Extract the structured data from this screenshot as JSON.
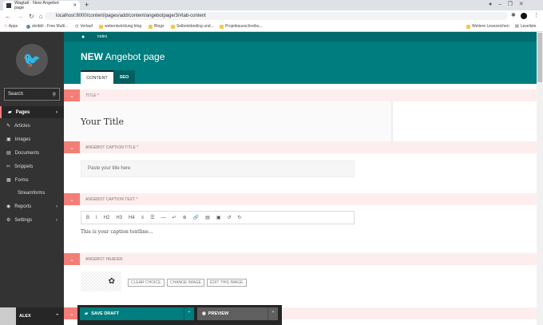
{
  "browser": {
    "tab_title": "Wagtail - New Angebot page",
    "url": "localhost:8000/content/pages/add/content/angebotpage/3/#tab-content",
    "bookmarks": [
      "Apps",
      "skribbl - Free Multi...",
      "Verlauf",
      "webentwicklung blog",
      "Blogs",
      "Selbstständing und...",
      "Projektausschreibu..."
    ],
    "other_bookmarks": "Weitere Lesezeichen",
    "reading_list": "Leseliste"
  },
  "sidebar": {
    "search_label": "Search",
    "items": [
      {
        "label": "Pages"
      },
      {
        "label": "Articles"
      },
      {
        "label": "Images"
      },
      {
        "label": "Documents"
      },
      {
        "label": "Snippets"
      },
      {
        "label": "Forms"
      },
      {
        "label": "Streamforms"
      },
      {
        "label": "Reports"
      },
      {
        "label": "Settings"
      }
    ],
    "user": "ALEX"
  },
  "header": {
    "breadcrumb": "index",
    "title_bold": "NEW",
    "title_rest": " Angebot page",
    "tabs": [
      "CONTENT",
      "SEO"
    ]
  },
  "fields": {
    "title_label": "TITLE",
    "title_value": "Your Title",
    "caption_title_label": "ANGEBOT CAPTION TITLE",
    "caption_title_placeholder": "Paste your title here",
    "caption_text_label": "ANGEBOT CAPTION TEXT",
    "toolbar": [
      "B",
      "I",
      "H2",
      "H3",
      "H4",
      "≡",
      "☰",
      "—",
      "↵",
      "⊛",
      "🔗",
      "▤",
      "▣",
      "↺",
      "↻"
    ],
    "caption_text_value": "This is your caption textline...",
    "header_label": "ANGEBOT HEADER",
    "image_buttons": [
      "CLEAR CHOICE",
      "CHANGE IMAGE",
      "EDIT THIS IMAGE"
    ]
  },
  "footer": {
    "save_draft": "SAVE DRAFT",
    "preview": "PREVIEW"
  },
  "colors": {
    "teal": "#007d7e",
    "salmon": "#f37e77",
    "sidebar": "#333333"
  }
}
